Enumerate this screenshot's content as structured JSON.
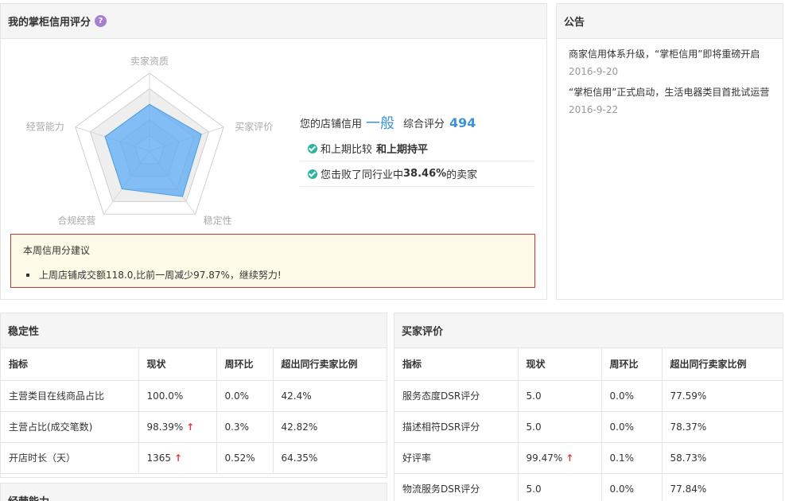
{
  "score_panel": {
    "title": "我的掌柜信用评分",
    "help_icon": "?",
    "radar": {
      "axes": [
        "卖家资质",
        "买家评价",
        "稳定性",
        "合规经营",
        "经营能力"
      ],
      "values": [
        0.6,
        0.7,
        0.72,
        0.6,
        0.6
      ],
      "fill_color": "#63adf2",
      "stroke_color": "#4a9de0"
    },
    "credit_prefix": "您的店铺信用",
    "credit_level": "一般",
    "score_label": "综合评分",
    "score_value": "494",
    "compare_prefix": "和上期比较",
    "compare_value": "和上期持平",
    "beat_prefix": "您击败了同行业中",
    "beat_value": "38.46%",
    "beat_suffix": "的卖家",
    "advice_title": "本周信用分建议",
    "advice_items": [
      "上周店铺成交额118.0,比前一周减少97.87%，继续努力!"
    ]
  },
  "notice_panel": {
    "title": "公告",
    "items": [
      {
        "text": "商家信用体系升级，“掌柜信用”即将重磅开启",
        "date": "2016-9-20"
      },
      {
        "text": "“掌柜信用”正式启动，生活电器类目首批试运营",
        "date": "2016-9-22"
      }
    ]
  },
  "stability": {
    "title": "稳定性",
    "columns": [
      "指标",
      "现状",
      "周环比",
      "超出同行卖家比例"
    ],
    "rows": [
      {
        "name": "主营类目在线商品占比",
        "value": "100.0%",
        "up": "",
        "wow": "0.0%",
        "ratio": "42.4%"
      },
      {
        "name": "主营占比(成交笔数)",
        "value": "98.39%",
        "up": "↑",
        "wow": "0.3%",
        "ratio": "42.82%"
      },
      {
        "name": "开店时长（天）",
        "value": "1365",
        "up": "↑",
        "wow": "0.52%",
        "ratio": "64.35%"
      }
    ]
  },
  "buyer_review": {
    "title": "买家评价",
    "columns": [
      "指标",
      "现状",
      "周环比",
      "超出同行卖家比例"
    ],
    "rows": [
      {
        "name": "服务态度DSR评分",
        "value": "5.0",
        "up": "",
        "wow": "0.0%",
        "ratio": "77.59%"
      },
      {
        "name": "描述相符DSR评分",
        "value": "5.0",
        "up": "",
        "wow": "0.0%",
        "ratio": "78.37%"
      },
      {
        "name": "好评率",
        "value": "99.47%",
        "up": "↑",
        "wow": "0.1%",
        "ratio": "58.73%"
      },
      {
        "name": "物流服务DSR评分",
        "value": "5.0",
        "up": "",
        "wow": "0.0%",
        "ratio": "77.84%"
      }
    ]
  },
  "operation": {
    "title": "经营能力"
  }
}
